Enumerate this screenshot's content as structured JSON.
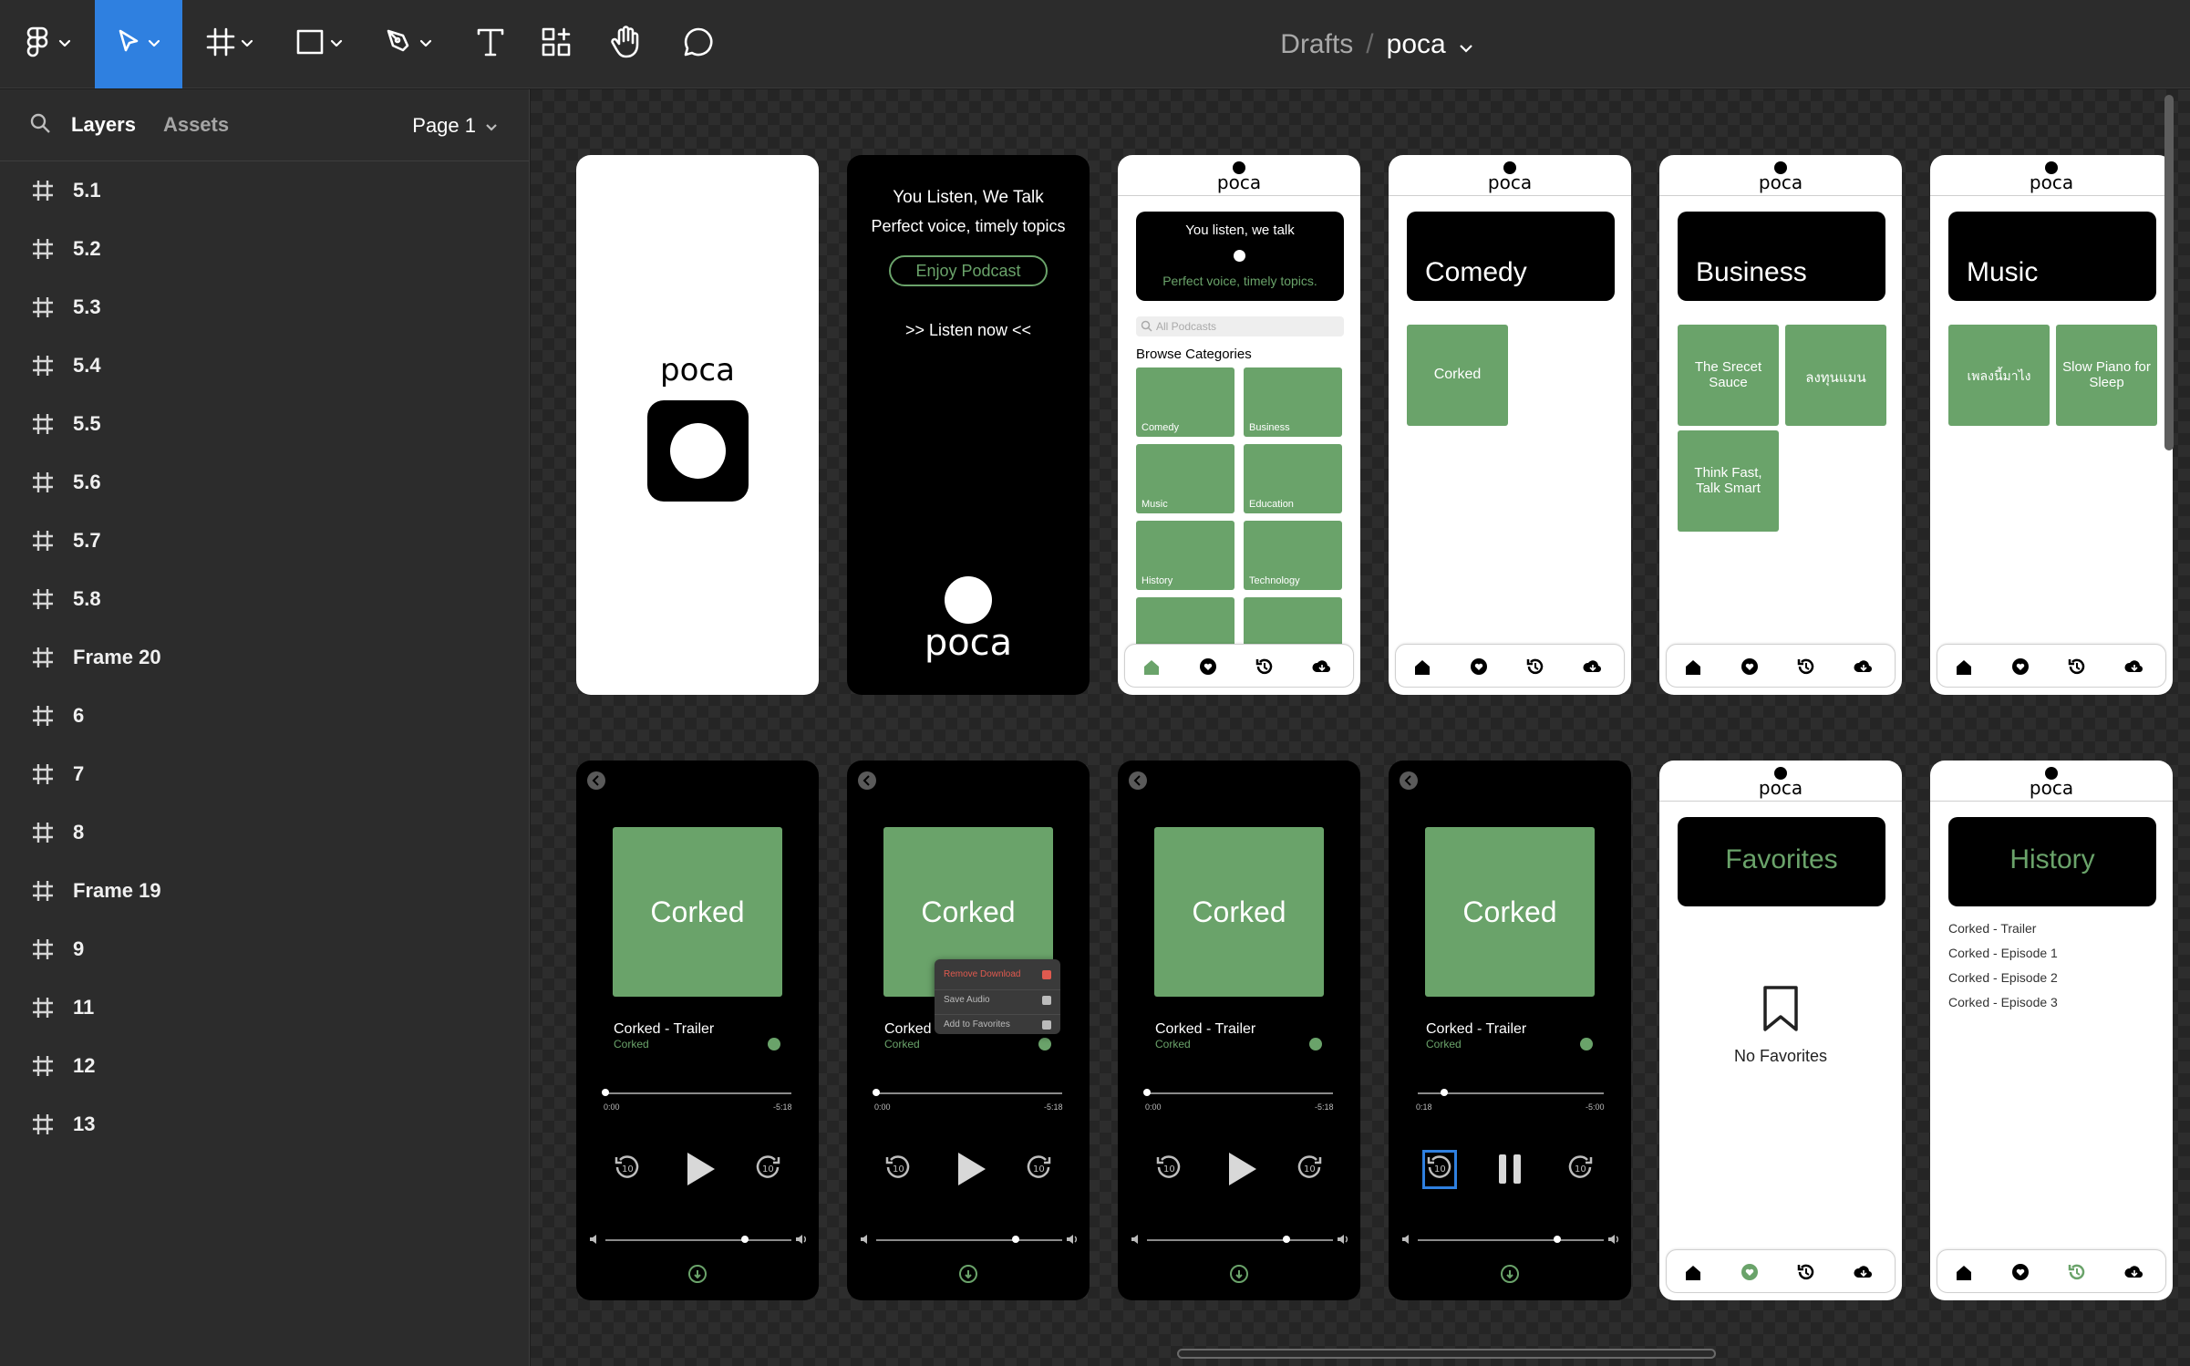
{
  "toolbar": {
    "tools": [
      "main-menu",
      "move",
      "frame",
      "shape",
      "pen",
      "text",
      "resources",
      "hand",
      "comment"
    ],
    "breadcrumb": {
      "project": "Drafts",
      "separator": "/",
      "file": "poca"
    }
  },
  "panel": {
    "tabs": {
      "layers": "Layers",
      "assets": "Assets"
    },
    "page": "Page 1",
    "layers": [
      "5.1",
      "5.2",
      "5.3",
      "5.4",
      "5.5",
      "5.6",
      "5.7",
      "5.8",
      "Frame 20",
      "6",
      "7",
      "8",
      "Frame 19",
      "9",
      "11",
      "12",
      "13"
    ]
  },
  "frames": {
    "splash": {
      "logo": "poca"
    },
    "intro": {
      "line1": "You Listen, We Talk",
      "line2": "Perfect voice, timely topics",
      "button": "Enjoy Podcast",
      "cta": ">> Listen now <<",
      "logo": "poca"
    },
    "home": {
      "logo": "poca",
      "banner_title": "You listen, we talk",
      "banner_sub": "Perfect voice, timely topics.",
      "search_placeholder": "All Podcasts",
      "section": "Browse Categories",
      "categories": [
        "Comedy",
        "Business",
        "Music",
        "Education",
        "History",
        "Technology"
      ]
    },
    "comedy": {
      "logo": "poca",
      "title": "Comedy",
      "items": [
        "Corked"
      ]
    },
    "business": {
      "logo": "poca",
      "title": "Business",
      "items": [
        "The Srecet Sauce",
        "ลงทุนแมน",
        "Think Fast, Talk Smart"
      ]
    },
    "music": {
      "logo": "poca",
      "title": "Music",
      "items": [
        "เพลงนี้มาไง",
        "Slow Piano for Sleep"
      ]
    },
    "player1": {
      "art": "Corked",
      "title": "Corked - Trailer",
      "show": "Corked",
      "start": "0:00",
      "end": "-5:18",
      "progress": 0.0,
      "volume": 0.75
    },
    "player2": {
      "art": "Corked",
      "title": "Corked",
      "show": "Corked",
      "start": "0:00",
      "end": "-5:18",
      "progress": 0.0,
      "volume": 0.75,
      "menu": [
        "Remove Download",
        "Save Audio",
        "Add to Favorites"
      ]
    },
    "player3": {
      "art": "Corked",
      "title": "Corked - Trailer",
      "show": "Corked",
      "start": "0:00",
      "end": "-5:18",
      "progress": 0.0,
      "volume": 0.75
    },
    "player4": {
      "art": "Corked",
      "title": "Corked - Trailer",
      "show": "Corked",
      "start": "0:18",
      "end": "-5:00",
      "progress": 0.14,
      "volume": 0.75
    },
    "favorites": {
      "logo": "poca",
      "title": "Favorites",
      "empty": "No Favorites"
    },
    "history": {
      "logo": "poca",
      "title": "History",
      "items": [
        "Corked - Trailer",
        "Corked - Episode 1",
        "Corked - Episode 2",
        "Corked - Episode 3"
      ]
    }
  },
  "colors": {
    "accent": "#6aa36a",
    "selection": "#2f80e0",
    "danger": "#e05a4f"
  }
}
